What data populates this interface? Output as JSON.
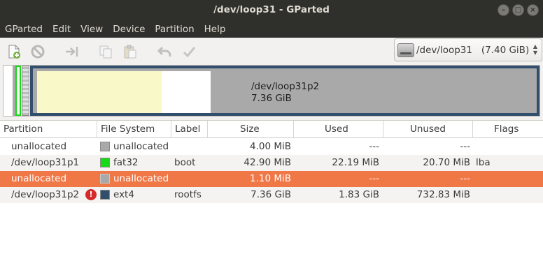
{
  "window": {
    "title": "/dev/loop31 - GParted"
  },
  "menu": [
    "GParted",
    "Edit",
    "View",
    "Device",
    "Partition",
    "Help"
  ],
  "toolbar": {
    "icons": [
      "new-partition-icon",
      "delete-icon",
      "resize-move-icon",
      "copy-icon",
      "paste-icon",
      "undo-icon",
      "apply-icon"
    ]
  },
  "device_select": {
    "value": "/dev/loop31   (7.40 GiB)"
  },
  "disk_map": {
    "name": "/dev/loop31p2",
    "size": "7.36 GiB"
  },
  "table": {
    "headers": [
      "Partition",
      "File System",
      "Label",
      "Size",
      "Used",
      "Unused",
      "Flags"
    ],
    "rows": [
      {
        "partition": "unallocated",
        "fs": "unallocated",
        "fs_color": "#a9a9a9",
        "label": "",
        "size": "4.00 MiB",
        "used": "---",
        "unused": "---",
        "flags": "",
        "warning": false,
        "selected": false
      },
      {
        "partition": "/dev/loop31p1",
        "fs": "fat32",
        "fs_color": "#18d918",
        "label": "boot",
        "size": "42.90 MiB",
        "used": "22.19 MiB",
        "unused": "20.70 MiB",
        "flags": "lba",
        "warning": false,
        "selected": false
      },
      {
        "partition": "unallocated",
        "fs": "unallocated",
        "fs_color": "#a9a9a9",
        "label": "",
        "size": "1.10 MiB",
        "used": "---",
        "unused": "---",
        "flags": "",
        "warning": false,
        "selected": true
      },
      {
        "partition": "/dev/loop31p2",
        "fs": "ext4",
        "fs_color": "#314e6c",
        "label": "rootfs",
        "size": "7.36 GiB",
        "used": "1.83 GiB",
        "unused": "732.83 MiB",
        "flags": "",
        "warning": true,
        "selected": false
      }
    ]
  },
  "colors": {
    "selected_row": "#f07746",
    "titlebar": "#2f2f2c",
    "ext4_used": "#f8f8c8",
    "ext4_border": "#314e6c",
    "fat32_border": "#18d918"
  }
}
